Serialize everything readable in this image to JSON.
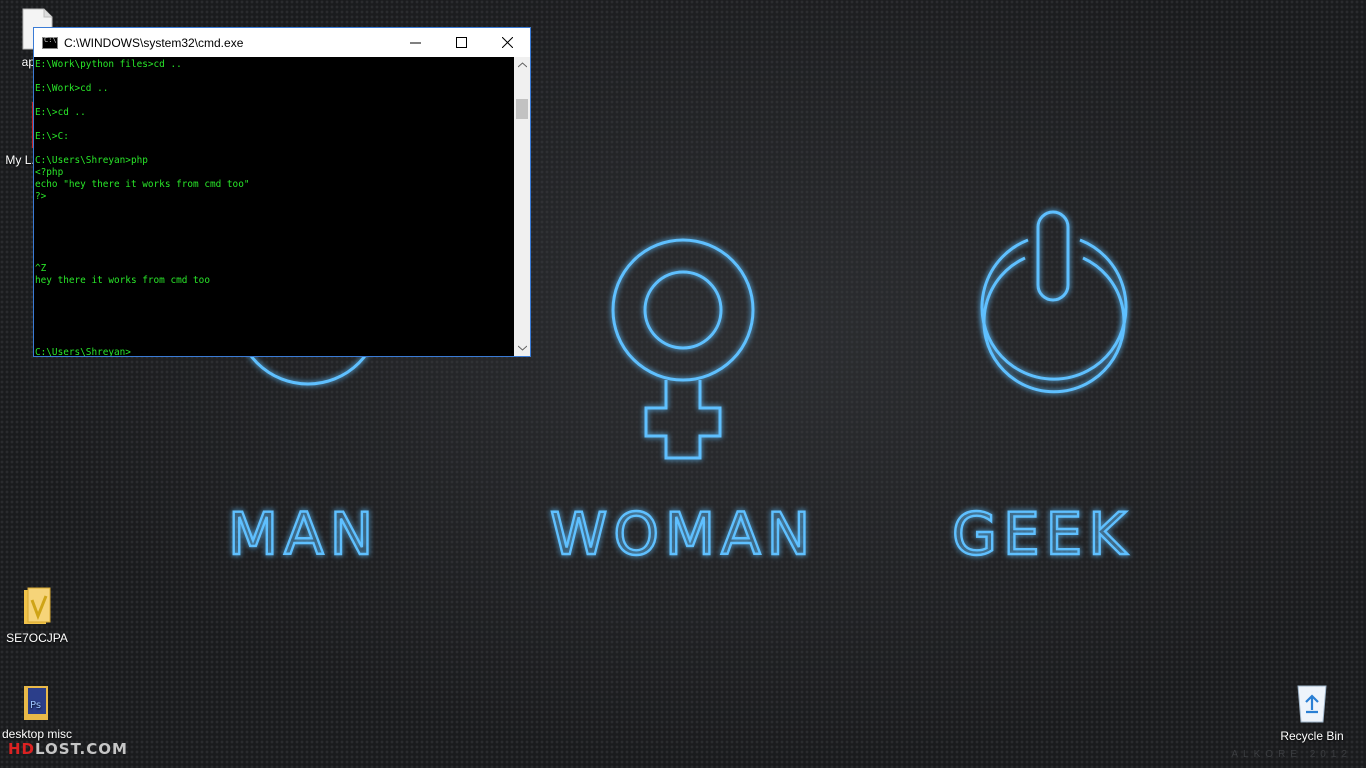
{
  "wallpaper": {
    "words": [
      "MAN",
      "WOMAN",
      "GEEK"
    ],
    "signature": "ALKORE 2012",
    "glow_color": "#5fc0ff"
  },
  "desktop": {
    "icons": [
      {
        "label": "app-d",
        "icon": "file-icon"
      },
      {
        "label": "My L... Va...",
        "icon": "shortcut-icon"
      },
      {
        "label": "SE7OCJPA",
        "icon": "folder-icon"
      },
      {
        "label": "desktop misc",
        "icon": "folder-icon"
      },
      {
        "label": "Recycle Bin",
        "icon": "recycle-bin-icon"
      }
    ],
    "brand": {
      "hd": "HD",
      "rest": "LOST.COM"
    }
  },
  "cmd_window": {
    "title": "C:\\WINDOWS\\system32\\cmd.exe",
    "console_text": "E:\\Work\\python files>cd ..\n\nE:\\Work>cd ..\n\nE:\\>cd ..\n\nE:\\>C:\n\nC:\\Users\\Shreyan>php\n<?php\necho \"hey there it works from cmd too\"\n?>\n\n\n\n\n\n^Z\nhey there it works from cmd too\n\n\n\n\n\nC:\\Users\\Shreyan>",
    "colors": {
      "text": "#29e629",
      "background": "#000000"
    }
  }
}
